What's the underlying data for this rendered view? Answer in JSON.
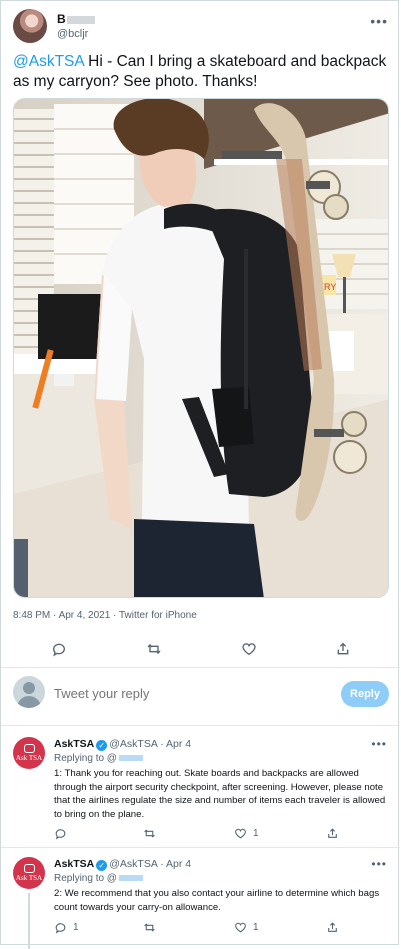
{
  "tweet": {
    "user_name_visible": "B",
    "handle": "@bcljr",
    "mention": "@AskTSA",
    "text": " Hi - Can I bring a skateboard and backpack as my carryon? See photo. Thanks!",
    "meta": "8:48 PM · Apr 4, 2021 · Twitter for iPhone"
  },
  "icons": {
    "reply": "reply-icon",
    "retweet": "retweet-icon",
    "like": "heart-icon",
    "share": "share-icon",
    "more": "more-icon",
    "verified": "verified-badge-icon"
  },
  "composer": {
    "placeholder": "Tweet your reply",
    "button_label": "Reply"
  },
  "replies": [
    {
      "avatar_label": "Ask TSA",
      "name": "AskTSA",
      "handle": "@AskTSA",
      "date": "· Apr 4",
      "replying_label": "Replying to @",
      "text": "1: Thank you for reaching out. Skate boards and backpacks are allowed through the airport security checkpoint, after screening. However, please note that the airlines regulate the size and number of items each traveler is allowed to bring on the plane.",
      "reply_count": "",
      "retweet_count": "",
      "like_count": "1"
    },
    {
      "avatar_label": "Ask TSA",
      "name": "AskTSA",
      "handle": "@AskTSA",
      "date": "· Apr 4",
      "replying_label": "Replying to @",
      "text": "2: We recommend that you also contact your airline to determine which bags count towards your carry-on allowance.",
      "reply_count": "1",
      "retweet_count": "",
      "like_count": "1"
    }
  ],
  "colors": {
    "accent": "#1d9bf0",
    "reply_button": "#8ecdf8",
    "tsa_red": "#d4344b"
  }
}
